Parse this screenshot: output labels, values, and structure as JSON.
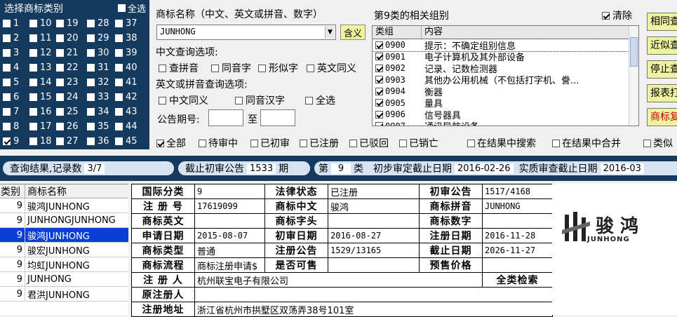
{
  "class_panel": {
    "title": "选择商标类别",
    "select_all": "全选",
    "classes": [
      [
        "1",
        "10",
        "19",
        "28",
        "37"
      ],
      [
        "2",
        "11",
        "20",
        "29",
        "38"
      ],
      [
        "3",
        "12",
        "21",
        "30",
        "39"
      ],
      [
        "4",
        "13",
        "22",
        "31",
        "40"
      ],
      [
        "5",
        "14",
        "23",
        "32",
        "41"
      ],
      [
        "6",
        "15",
        "24",
        "33",
        "42"
      ],
      [
        "7",
        "16",
        "25",
        "34",
        "43"
      ],
      [
        "8",
        "17",
        "26",
        "35",
        "44"
      ],
      [
        "9",
        "18",
        "27",
        "36",
        "45"
      ]
    ],
    "checked": "9"
  },
  "search": {
    "name_label": "商标名称（中文、英文或拼音、数字）",
    "name_value": "JUNHONG",
    "meaning_button": "含义",
    "cn_options_label": "中文查询选项:",
    "cn_options": [
      "查拼音",
      "同音字",
      "形似字",
      "英文同义"
    ],
    "en_options_label": "英文或拼音查询选项:",
    "en_options": [
      "中文同义",
      "同音汉字",
      "全选"
    ],
    "pub_label": "公告期号:",
    "pub_to": "至",
    "pub_from_value": "",
    "pub_to_value": ""
  },
  "groups": {
    "title": "第9类的相关组别",
    "clear_label": "清除",
    "col_group": "类组",
    "col_content": "内容",
    "rows": [
      {
        "code": "0900",
        "text": "提示：不确定组别信息"
      },
      {
        "code": "0901",
        "text": "电子计算机及其外部设备"
      },
      {
        "code": "0902",
        "text": "记录、记数检测器"
      },
      {
        "code": "0903",
        "text": "其他办公用机械（不包括打字机、誊..."
      },
      {
        "code": "0904",
        "text": "衡器"
      },
      {
        "code": "0905",
        "text": "量具"
      },
      {
        "code": "0906",
        "text": "信号器具"
      },
      {
        "code": "0907",
        "text": "通讯导航设备"
      }
    ]
  },
  "right_buttons": [
    "相同查",
    "近似查",
    "停止查",
    "报表打",
    "商标复"
  ],
  "filters": [
    {
      "label": "全部",
      "checked": true
    },
    {
      "label": "待审中",
      "checked": false
    },
    {
      "label": "已初审",
      "checked": false
    },
    {
      "label": "已注册",
      "checked": false
    },
    {
      "label": "已驳回",
      "checked": false
    },
    {
      "label": "已销亡",
      "checked": false
    },
    {
      "label": "在结果中搜索",
      "checked": false
    },
    {
      "label": "在结果中合并",
      "checked": false
    },
    {
      "label": "类似",
      "checked": false
    }
  ],
  "status": {
    "result_label": "查询结果,记录数",
    "result_value": "3/7",
    "deadline_label": "截止初审公告",
    "deadline_value": "1533",
    "deadline_unit": "期",
    "class_prefix": "第",
    "class_value": "9",
    "class_suffix": "类",
    "prelim_label": "初步审定截止日期",
    "prelim_value": "2016-02-26",
    "subst_label": "实质审查截止日期",
    "subst_value": "2016-03"
  },
  "results": {
    "col_class": "类别",
    "col_name": "商标名称",
    "rows": [
      {
        "cls": "9",
        "name": "骏鸿JUNHONG"
      },
      {
        "cls": "9",
        "name": "JUNHONGJUNHONG"
      },
      {
        "cls": "9",
        "name": "骏鸿JUNHONG"
      },
      {
        "cls": "9",
        "name": "骏宏JUNHONG"
      },
      {
        "cls": "9",
        "name": "均虹JUNHONG"
      },
      {
        "cls": "9",
        "name": "JUNHONG"
      },
      {
        "cls": "9",
        "name": "君洪JUNHONG"
      }
    ],
    "selected_index": 2
  },
  "detail": {
    "intl_class_k": "国际分类",
    "intl_class": "9",
    "legal_status_k": "法律状态",
    "legal_status": "已注册",
    "prelim_pub_k": "初审公告",
    "prelim_pub": "1517/4168",
    "reg_no_k": "注 册 号",
    "reg_no": "17619099",
    "cn_name_k": "商标中文",
    "cn_name": "骏鸿",
    "pinyin_k": "商标拼音",
    "pinyin": "JUNHONG",
    "en_k": "商标英文",
    "en": "",
    "head_k": "商标字头",
    "head": "",
    "digit_k": "商标数字",
    "digit": "",
    "apply_date_k": "申请日期",
    "apply_date": "2015-08-07",
    "prelim_date_k": "初审日期",
    "prelim_date": "2016-08-27",
    "reg_date_k": "注册日期",
    "reg_date": "2016-11-28",
    "type_k": "商标类型",
    "type": "普通",
    "reg_pub_k": "注册公告",
    "reg_pub": "1529/13165",
    "expire_k": "截止日期",
    "expire": "2026-11-27",
    "flow_k": "商标流程",
    "flow": "商标注册申请$",
    "sale_k": "是否可售",
    "sale": "",
    "price_k": "预售价格",
    "price": "",
    "registrant_k": "注 册 人",
    "registrant": "杭州联宝电子有限公司",
    "all_class": "全类检索",
    "orig_registrant_k": "原注册人",
    "orig_registrant": "",
    "address_k": "注册地址",
    "address": "浙江省杭州市拱墅区双荡弄38号101室"
  },
  "logo": {
    "cn": "骏 鸿",
    "en": "JUNHONG"
  }
}
